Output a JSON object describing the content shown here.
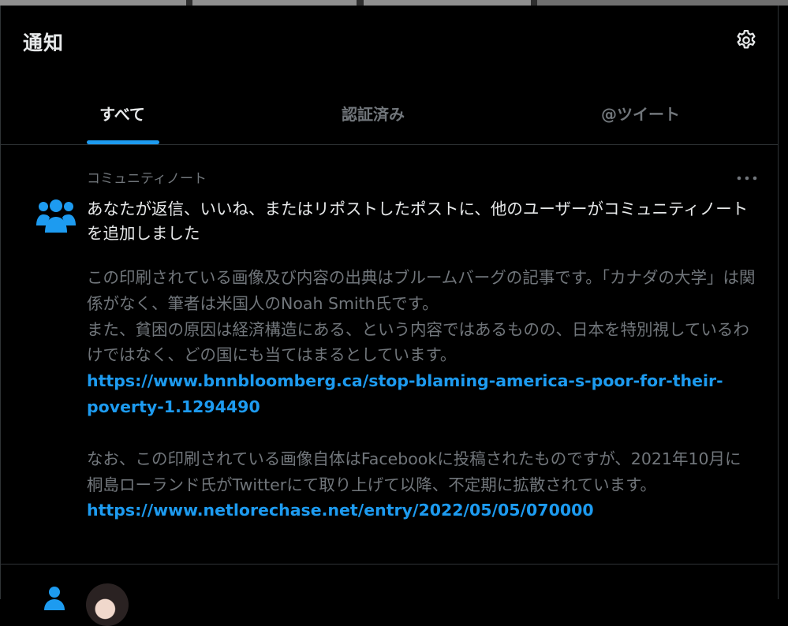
{
  "header": {
    "title": "通知"
  },
  "tabs": [
    {
      "label": "すべて",
      "active": true
    },
    {
      "label": "認証済み",
      "active": false
    },
    {
      "label": "@ツイート",
      "active": false
    }
  ],
  "notification": {
    "kicker": "コミュニティノート",
    "headline": "あなたが返信、いいね、またはリポストしたポストに、他のユーザーがコミュニティノートを追加しました",
    "body": {
      "line1": "この印刷されている画像及び内容の出典はブルームバーグの記事です。「カナダの大学」は関係がなく、筆者は米国人のNoah Smith氏です。",
      "line2": "また、貧困の原因は経済構造にある、という内容ではあるものの、日本を特別視しているわけではなく、どの国にも当てはまるとしています。",
      "link1": "https://www.bnnbloomberg.ca/stop-blaming-america-s-poor-for-their-poverty-1.1294490",
      "line3": "なお、この印刷されている画像自体はFacebookに投稿されたものですが、2021年10月に桐島ローランド氏がTwitterにて取り上げて以降、不定期に拡散されています。",
      "link2": "https://www.netlorechase.net/entry/2022/05/05/070000"
    }
  },
  "colors": {
    "background": "#000000",
    "text_primary": "#e7e9ea",
    "text_secondary": "#71767b",
    "accent": "#1d9bf0",
    "border": "#2f3336"
  },
  "icons": {
    "settings": "gear-icon",
    "more": "more-horizontal-icon",
    "community": "people-icon",
    "follow": "person-icon"
  }
}
